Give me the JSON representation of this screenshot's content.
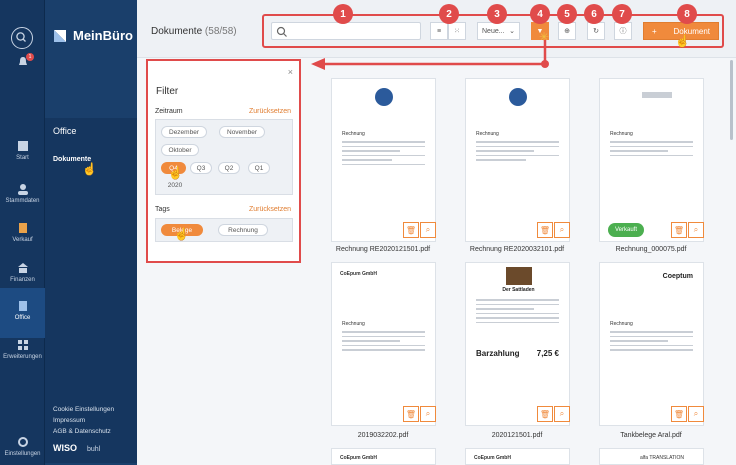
{
  "app": {
    "name": "MeinBüro"
  },
  "rail": {
    "items": [
      {
        "label": "Start"
      },
      {
        "label": "Stammdaten"
      },
      {
        "label": "Verkauf"
      },
      {
        "label": "Finanzen"
      },
      {
        "label": "Office"
      },
      {
        "label": "Erweiterungen"
      },
      {
        "label": "Einstellungen"
      }
    ],
    "notification_count": "1"
  },
  "nav": {
    "section": "Office",
    "sub_item": "Dokumente",
    "links": [
      "Cookie Einstellungen",
      "Impressum",
      "AGB & Datenschutz"
    ],
    "footer_logo": "WISO",
    "footer_brand": "buhl"
  },
  "header": {
    "title": "Dokumente",
    "count": "(58/58)",
    "sort_label": "Neue...",
    "new_button": "Dokument",
    "new_plus": "+"
  },
  "badges": [
    "1",
    "2",
    "3",
    "4",
    "5",
    "6",
    "7",
    "8"
  ],
  "filter": {
    "title": "Filter",
    "close": "×",
    "period_label": "Zeitraum",
    "reset_label": "Zurücksetzen",
    "months": [
      "Dezember",
      "November",
      "Oktober"
    ],
    "quarters": [
      "Q4",
      "Q3",
      "Q2",
      "Q1"
    ],
    "year": "2020",
    "tags_label": "Tags",
    "tags_reset": "Zurücksetzen",
    "tags": [
      "Belege",
      "Rechnung"
    ]
  },
  "documents": [
    {
      "name": "Rechnung RE2020121501.pdf",
      "heading": "Rechnung"
    },
    {
      "name": "Rechnung RE2020032101.pdf",
      "heading": "Rechnung"
    },
    {
      "name": "Rechnung_000075.pdf",
      "heading": "Rechnung",
      "tag": "Verkauft"
    },
    {
      "name": "2019032202.pdf",
      "heading": "Rechnung",
      "company": "CoEpum GmbH"
    },
    {
      "name": "2020121501.pdf",
      "heading": "Der Sattladen",
      "sub": "Barzahlung",
      "amount": "7,25 €"
    },
    {
      "name": "Tankbelege Aral.pdf",
      "heading": "Rechnung",
      "company": "Coeptum"
    }
  ],
  "bottom_row": [
    "CoEpum GmbH",
    "CoEpum GmbH",
    "alfa TRANSLATION"
  ],
  "colors": {
    "accent": "#f08a3c",
    "annotation": "#e04b4b",
    "rail": "#15365f"
  }
}
